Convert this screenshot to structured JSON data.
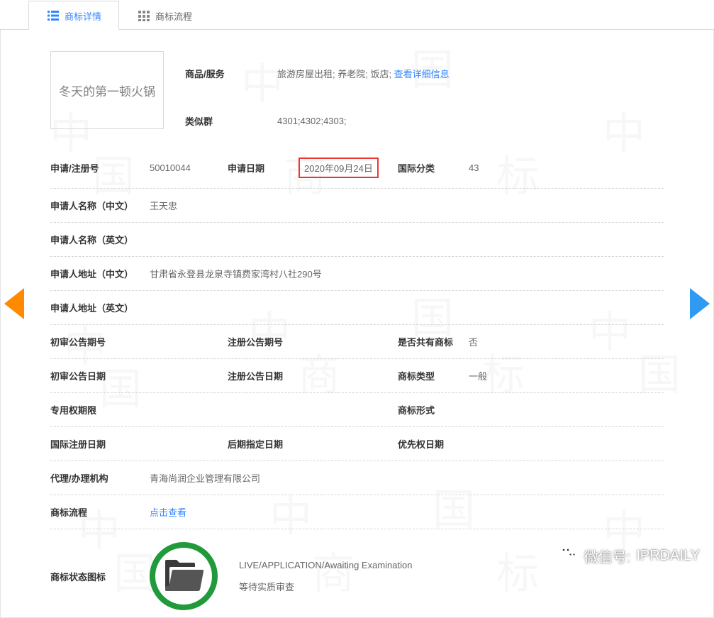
{
  "tabs": {
    "detail": "商标详情",
    "process": "商标流程"
  },
  "trademark_name": "冬天的第一顿火锅",
  "goods_services": {
    "label": "商品/服务",
    "value": "旅游房屋出租; 养老院; 饭店; ",
    "more_link": "查看详细信息"
  },
  "similar_group": {
    "label": "类似群",
    "value": "4301;4302;4303;"
  },
  "row1": {
    "reg_no_label": "申请/注册号",
    "reg_no": "50010044",
    "app_date_label": "申请日期",
    "app_date": "2020年09月24日",
    "intl_class_label": "国际分类",
    "intl_class": "43"
  },
  "applicant_name_cn": {
    "label": "申请人名称（中文）",
    "value": "王天忠"
  },
  "applicant_name_en": {
    "label": "申请人名称（英文）",
    "value": ""
  },
  "applicant_addr_cn": {
    "label": "申请人地址（中文）",
    "value": "甘肃省永登县龙泉寺镇费家湾村八社290号"
  },
  "applicant_addr_en": {
    "label": "申请人地址（英文）",
    "value": ""
  },
  "row6": {
    "c1l": "初审公告期号",
    "c1v": "",
    "c2l": "注册公告期号",
    "c2v": "",
    "c3l": "是否共有商标",
    "c3v": "否"
  },
  "row7": {
    "c1l": "初审公告日期",
    "c1v": "",
    "c2l": "注册公告日期",
    "c2v": "",
    "c3l": "商标类型",
    "c3v": "一般"
  },
  "row8": {
    "c1l": "专用权期限",
    "c1v": "",
    "c3l": "商标形式",
    "c3v": ""
  },
  "row9": {
    "c1l": "国际注册日期",
    "c1v": "",
    "c2l": "后期指定日期",
    "c2v": "",
    "c3l": "优先权日期",
    "c3v": ""
  },
  "agency": {
    "label": "代理/办理机构",
    "value": "青海尚润企业管理有限公司"
  },
  "process": {
    "label": "商标流程",
    "link": "点击查看"
  },
  "status": {
    "label": "商标状态图标",
    "line1": "LIVE/APPLICATION/Awaiting Examination",
    "line2": "等待实质审查"
  },
  "footer": {
    "wx_label": "微信号:",
    "wx_id": " IPRDAILY"
  }
}
